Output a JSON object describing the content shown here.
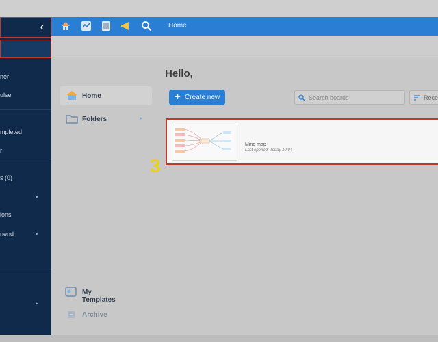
{
  "sidebar": {
    "items": [
      {
        "label": "ner",
        "has_arrow": false
      },
      {
        "label": "ulse",
        "has_arrow": false
      },
      {
        "label": "mpleted",
        "has_arrow": false
      },
      {
        "label": "r",
        "has_arrow": false
      },
      {
        "label": "s (0)",
        "has_arrow": false
      },
      {
        "label": "",
        "has_arrow": true
      },
      {
        "label": "ions",
        "has_arrow": false
      },
      {
        "label": "nend",
        "has_arrow": true
      },
      {
        "label": "",
        "has_arrow": true
      }
    ]
  },
  "header": {
    "breadcrumb": "Home",
    "icons": [
      "home-icon",
      "activity-icon",
      "list-icon",
      "megaphone-icon",
      "search-icon"
    ]
  },
  "nav": {
    "home": "Home",
    "folders": "Folders",
    "templates": "My Templates",
    "archive": "Archive"
  },
  "main": {
    "greeting": "Hello,",
    "create_label": "Create new",
    "search_placeholder": "Search boards",
    "sort_label": "Recen"
  },
  "board": {
    "title": "Mind map",
    "subtitle": "Last opened: Today 10:04"
  },
  "annotation": {
    "step": "3"
  },
  "colors": {
    "header_blue": "#2a7fd4",
    "sidebar_navy": "#0f2a4a",
    "highlight_red": "#c0392b",
    "step_yellow": "#e8d21a"
  }
}
